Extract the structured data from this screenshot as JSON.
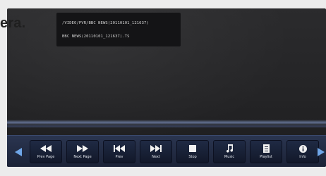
{
  "overlay_text": "era.",
  "file_info": {
    "path": "/VIDEO/PVR/BBC NEWS(20110101_121637)",
    "name": "BBC NEWS(20110101_121637).TS"
  },
  "toolbar": {
    "buttons": [
      {
        "label": "Prev Page",
        "icon": "rewind-icon",
        "active": true
      },
      {
        "label": "Next Page",
        "icon": "fast-forward-icon",
        "active": false
      },
      {
        "label": "Prev",
        "icon": "skip-back-icon",
        "active": false
      },
      {
        "label": "Next",
        "icon": "skip-forward-icon",
        "active": false
      },
      {
        "label": "Stop",
        "icon": "stop-icon",
        "active": false
      },
      {
        "label": "Music",
        "icon": "music-note-icon",
        "active": false
      },
      {
        "label": "Playlist",
        "icon": "playlist-icon",
        "active": false
      },
      {
        "label": "Info",
        "icon": "info-icon",
        "active": false
      }
    ]
  },
  "colors": {
    "toolbar_bg": "#1b2236",
    "active_button": "#3e66ad",
    "arrow_accent": "#6fa6e8"
  }
}
